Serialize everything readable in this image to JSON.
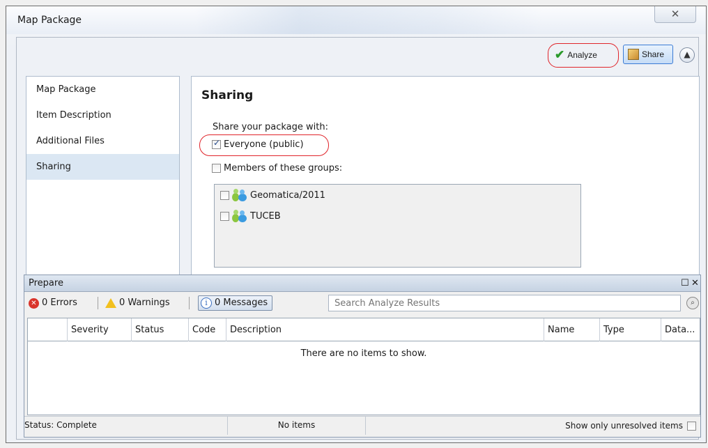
{
  "window": {
    "title": "Map Package",
    "close_glyph": "✕"
  },
  "toolbar": {
    "analyze_label": "Analyze",
    "share_label": "Share"
  },
  "nav": {
    "items": [
      {
        "label": "Map Package"
      },
      {
        "label": "Item Description"
      },
      {
        "label": "Additional Files"
      },
      {
        "label": "Sharing",
        "active": true
      }
    ]
  },
  "sharing": {
    "title": "Sharing",
    "share_with_label": "Share your package with:",
    "everyone": {
      "label": "Everyone (public)",
      "checked": true
    },
    "members": {
      "label": "Members of these groups:",
      "checked": false
    },
    "groups": [
      {
        "label": "Geomatica/2011",
        "checked": false
      },
      {
        "label": "TUCEB",
        "checked": false
      }
    ]
  },
  "prepare": {
    "title": "Prepare",
    "errors": "0 Errors",
    "warnings": "0 Warnings",
    "messages": "0 Messages",
    "search_placeholder": "Search Analyze Results",
    "columns": [
      "Severity",
      "Status",
      "Code",
      "Description",
      "Name",
      "Type",
      "Data..."
    ],
    "empty_text": "There are no items to show.",
    "status": "Status: Complete",
    "items": "No items",
    "unresolved": "Show only unresolved items"
  },
  "colors": {
    "highlight_oval": "#e0242a",
    "active_nav": "#dbe7f3",
    "accent": "#3a7bd5"
  }
}
